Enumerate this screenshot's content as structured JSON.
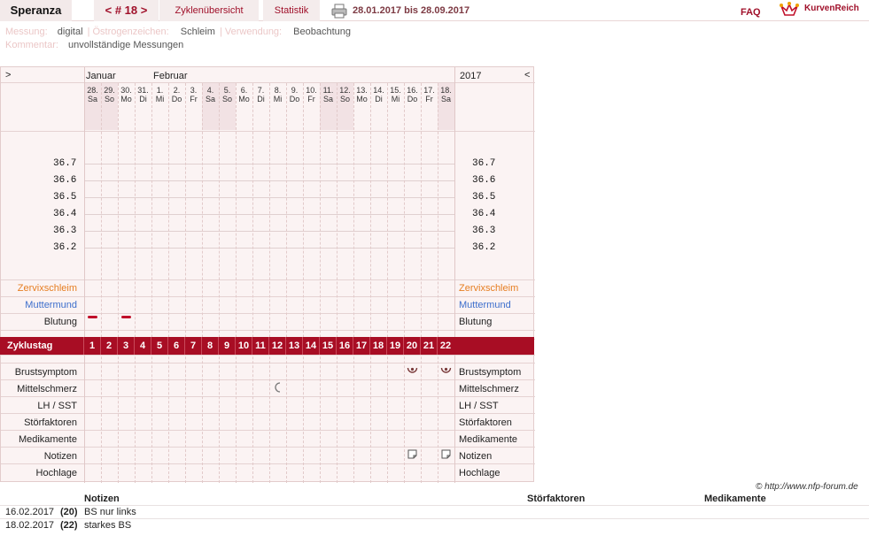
{
  "topbar": {
    "app_name": "Speranza",
    "cycle_label": "< # 18 >",
    "tab_overview": "Zyklenübersicht",
    "tab_stats": "Statistik",
    "date_range": "28.01.2017 bis 28.09.2017",
    "faq": "FAQ",
    "brand": "KurvenReich"
  },
  "meta": {
    "messung_label": "Messung:",
    "messung_value": "digital",
    "oestrogen_label": "Östrogenzeichen:",
    "oestrogen_value": "Schleim",
    "verwendung_label": "Verwendung:",
    "verwendung_value": "Beobachtung",
    "kommentar_label": "Kommentar:",
    "kommentar_value": "unvollständige Messungen"
  },
  "chart": {
    "nav_left": ">",
    "nav_right": "<",
    "month1": "Januar",
    "month2": "Februar",
    "year": "2017",
    "days": [
      {
        "d": "28.",
        "w": "Sa",
        "weekend": true
      },
      {
        "d": "29.",
        "w": "So",
        "weekend": true
      },
      {
        "d": "30.",
        "w": "Mo",
        "weekend": false
      },
      {
        "d": "31.",
        "w": "Di",
        "weekend": false
      },
      {
        "d": "1.",
        "w": "Mi",
        "weekend": false
      },
      {
        "d": "2.",
        "w": "Do",
        "weekend": false
      },
      {
        "d": "3.",
        "w": "Fr",
        "weekend": false
      },
      {
        "d": "4.",
        "w": "Sa",
        "weekend": true
      },
      {
        "d": "5.",
        "w": "So",
        "weekend": true
      },
      {
        "d": "6.",
        "w": "Mo",
        "weekend": false
      },
      {
        "d": "7.",
        "w": "Di",
        "weekend": false
      },
      {
        "d": "8.",
        "w": "Mi",
        "weekend": false
      },
      {
        "d": "9.",
        "w": "Do",
        "weekend": false
      },
      {
        "d": "10.",
        "w": "Fr",
        "weekend": false
      },
      {
        "d": "11.",
        "w": "Sa",
        "weekend": true
      },
      {
        "d": "12.",
        "w": "So",
        "weekend": true
      },
      {
        "d": "13.",
        "w": "Mo",
        "weekend": false
      },
      {
        "d": "14.",
        "w": "Di",
        "weekend": false
      },
      {
        "d": "15.",
        "w": "Mi",
        "weekend": false
      },
      {
        "d": "16.",
        "w": "Do",
        "weekend": false
      },
      {
        "d": "17.",
        "w": "Fr",
        "weekend": false
      },
      {
        "d": "18.",
        "w": "Sa",
        "weekend": true
      }
    ],
    "temps": [
      "36.7",
      "36.6",
      "36.5",
      "36.4",
      "36.3",
      "36.2"
    ],
    "row_labels": {
      "zervix": "Zervixschleim",
      "muttermund": "Muttermund",
      "blutung": "Blutung",
      "zyklustag": "Zyklustag",
      "brust": "Brustsymptom",
      "mittel": "Mittelschmerz",
      "lh": "LH / SST",
      "stoer": "Störfaktoren",
      "medi": "Medikamente",
      "notizen": "Notizen",
      "hochlage": "Hochlage"
    },
    "cycle_days": [
      "1",
      "2",
      "3",
      "4",
      "5",
      "6",
      "7",
      "8",
      "9",
      "10",
      "11",
      "12",
      "13",
      "14",
      "15",
      "16",
      "17",
      "18",
      "19",
      "20",
      "21",
      "22"
    ],
    "bleeding_days": [
      1,
      3
    ],
    "breast_days": [
      20,
      22
    ],
    "mittelschmerz_days": [
      12
    ],
    "notes_days": [
      20,
      22
    ],
    "colors": {
      "accent": "#a80d24",
      "zervix": "#e67e22",
      "muttermund": "#3c6ecc"
    }
  },
  "footer": {
    "copyright": "© http://www.nfp-forum.de",
    "col_notizen": "Notizen",
    "col_stoer": "Störfaktoren",
    "col_medi": "Medikamente",
    "rows": [
      {
        "date": "16.02.2017",
        "day": "(20)",
        "note": "BS nur links"
      },
      {
        "date": "18.02.2017",
        "day": "(22)",
        "note": "starkes BS"
      }
    ]
  }
}
